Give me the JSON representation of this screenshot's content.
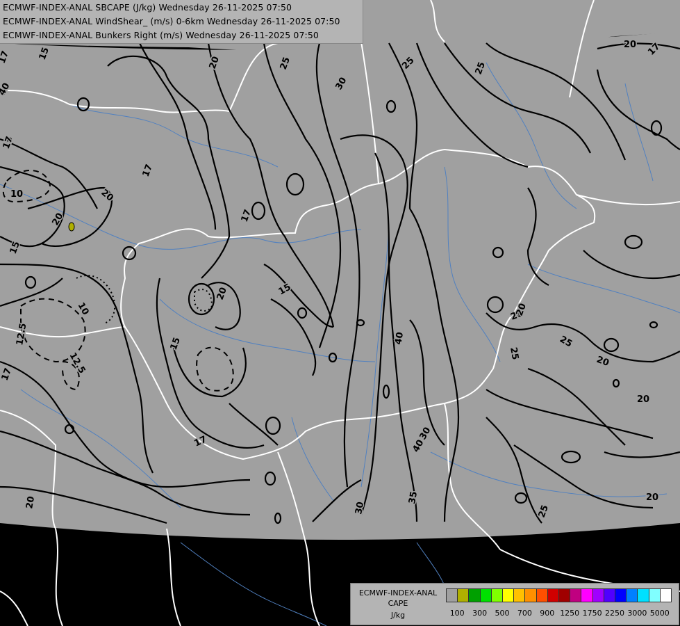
{
  "header": {
    "line1": "ECMWF-INDEX-ANAL SBCAPE (J/kg) Wednesday 26-11-2025 07:50",
    "line2": "ECMWF-INDEX-ANAL WindShear_ (m/s) 0-6km Wednesday 26-11-2025 07:50",
    "line3": "ECMWF-INDEX-ANAL Bunkers Right (m/s) Wednesday 26-11-2025 07:50"
  },
  "legend": {
    "title1": "ECMWF-INDEX-ANAL",
    "title2": "CAPE",
    "title3": "J/kg",
    "colors": [
      "#a0a0a0",
      "#b0b000",
      "#00a000",
      "#00e000",
      "#80ff00",
      "#ffff00",
      "#ffc000",
      "#ff9000",
      "#ff5000",
      "#d00000",
      "#a00000",
      "#c00080",
      "#ff00ff",
      "#a000ff",
      "#5000ff",
      "#0000ff",
      "#0080ff",
      "#00e0ff",
      "#80ffff",
      "#ffffff"
    ],
    "ticks": [
      "100",
      "300",
      "500",
      "700",
      "900",
      "1250",
      "1750",
      "2250",
      "3000",
      "5000"
    ]
  },
  "map": {
    "background_color": "#a0a0a0",
    "outside_color": "#000000",
    "border_color": "#ffffff",
    "river_color": "#5080c0",
    "contour_color": "#000000",
    "contour_labels": [
      "17",
      "20",
      "15",
      "15",
      "10",
      "20",
      "20",
      "17",
      "20",
      "25",
      "20",
      "17",
      "25",
      "30",
      "25",
      "25",
      "20",
      "20",
      "15",
      "20",
      "15",
      "17",
      "15",
      "12.5",
      "12.5",
      "10",
      "17",
      "20",
      "40",
      "30",
      "35",
      "40",
      "20",
      "17",
      "25",
      "20",
      "20",
      "30",
      "25",
      "17",
      "15",
      "40",
      "17"
    ]
  }
}
